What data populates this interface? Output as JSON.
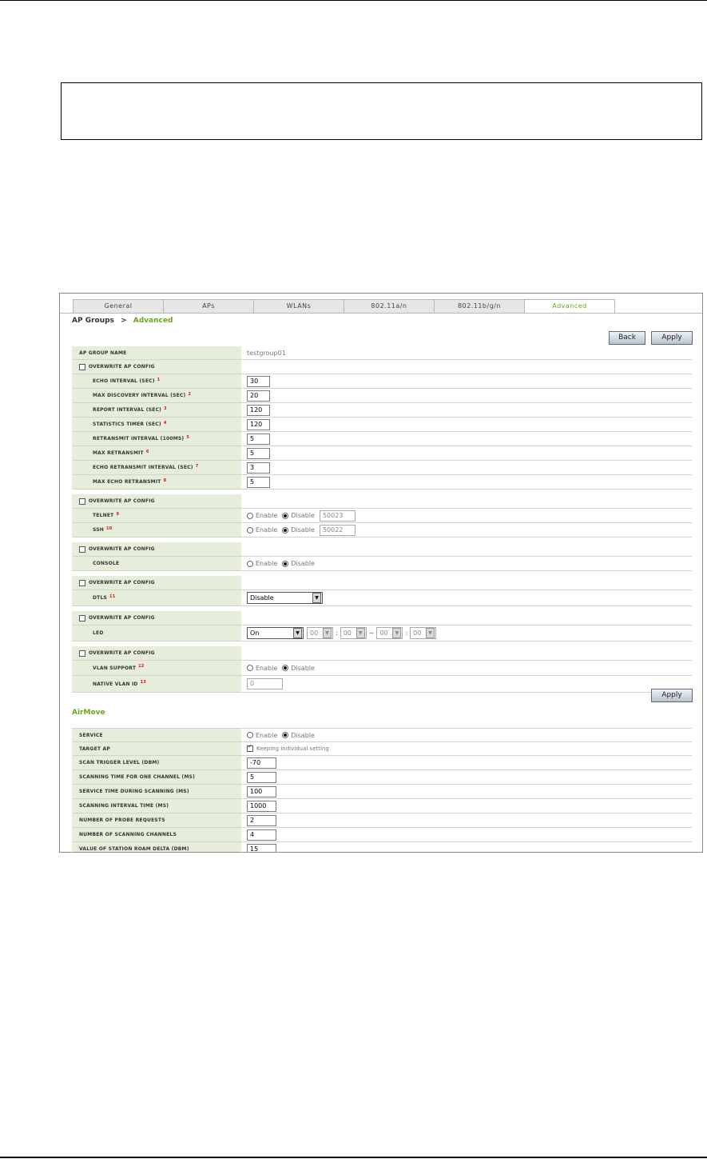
{
  "tabs": [
    "General",
    "APs",
    "WLANs",
    "802.11a/n",
    "802.11b/g/n",
    "Advanced"
  ],
  "breadcrumb": {
    "root": "AP Groups",
    "sep": ">",
    "current": "Advanced"
  },
  "buttons": {
    "back": "Back",
    "apply": "Apply"
  },
  "group_name": {
    "label": "AP GROUP NAME",
    "value": "testgroup01"
  },
  "overwrite_label": "OVERWRITE AP CONFIG",
  "intervals": [
    {
      "label": "ECHO INTERVAL (SEC)",
      "note": "1",
      "value": "30"
    },
    {
      "label": "MAX DISCOVERY INTERVAL (SEC)",
      "note": "2",
      "value": "20"
    },
    {
      "label": "REPORT INTERVAL (SEC)",
      "note": "3",
      "value": "120"
    },
    {
      "label": "STATISTICS TIMER (SEC)",
      "note": "4",
      "value": "120"
    },
    {
      "label": "RETRANSMIT INTERVAL (100MS)",
      "note": "5",
      "value": "5"
    },
    {
      "label": "MAX RETRANSMIT",
      "note": "6",
      "value": "5"
    },
    {
      "label": "ECHO RETRANSMIT INTERVAL (SEC)",
      "note": "7",
      "value": "3"
    },
    {
      "label": "MAX ECHO RETRANSMIT",
      "note": "8",
      "value": "5"
    }
  ],
  "radio": {
    "enable": "Enable",
    "disable": "Disable"
  },
  "telnet": {
    "label": "TELNET",
    "note": "9",
    "port": "50023"
  },
  "ssh": {
    "label": "SSH",
    "note": "10",
    "port": "50022"
  },
  "console": {
    "label": "CONSOLE"
  },
  "dtls": {
    "label": "DTLS",
    "note": "11",
    "value": "Disable"
  },
  "led": {
    "label": "LED",
    "mode": "On",
    "h1": "00",
    "m1": "00",
    "tilde": "~",
    "h2": "00",
    "m2": "00"
  },
  "vlan_support": {
    "label": "VLAN SUPPORT",
    "note": "12"
  },
  "native_vlan": {
    "label": "NATIVE VLAN ID",
    "note": "13",
    "value": "0"
  },
  "airmove": {
    "title": "AirMove",
    "service": "SERVICE",
    "target_ap": "TARGET AP",
    "target_ap_value": "Keeping individual setting",
    "rows": [
      {
        "label": "SCAN TRIGGER LEVEL (DBM)",
        "value": "-70"
      },
      {
        "label": "SCANNING TIME FOR ONE CHANNEL (MS)",
        "value": "5"
      },
      {
        "label": "SERVICE TIME DURING SCANNING (MS)",
        "value": "100"
      },
      {
        "label": "SCANNING INTERVAL TIME (MS)",
        "value": "1000"
      },
      {
        "label": "NUMBER OF PROBE REQUESTS",
        "value": "2"
      },
      {
        "label": "NUMBER OF SCANNING CHANNELS",
        "value": "4"
      },
      {
        "label": "VALUE OF STATION ROAM DELTA (DBM)",
        "value": "15"
      }
    ]
  }
}
